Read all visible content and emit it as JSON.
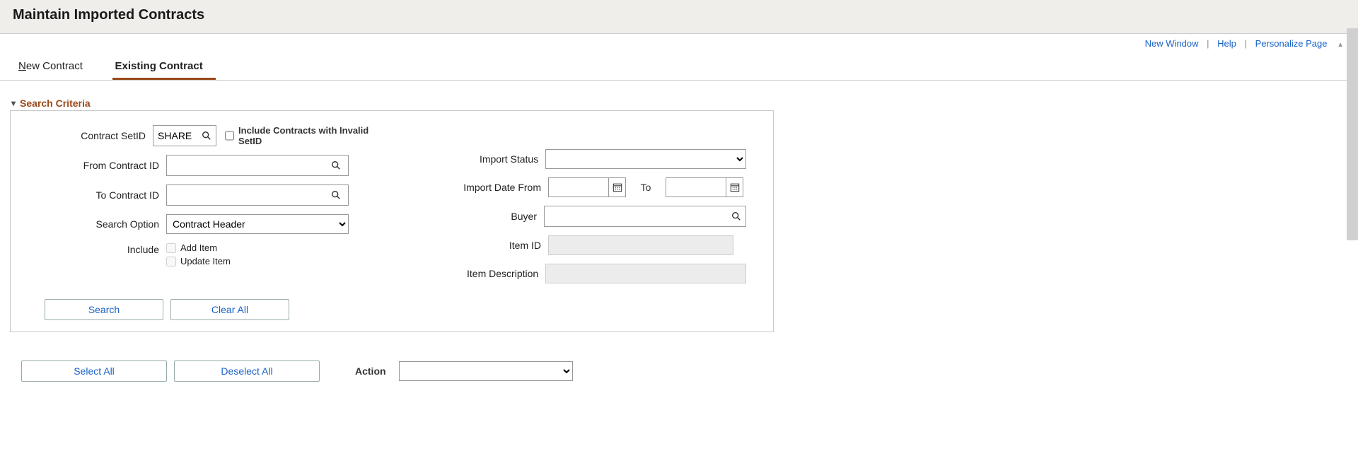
{
  "header": {
    "title": "Maintain Imported Contracts"
  },
  "toplinks": {
    "new_window": "New Window",
    "help": "Help",
    "personalize": "Personalize Page"
  },
  "tabs": {
    "new_contract_first": "N",
    "new_contract_rest": "ew Contract",
    "existing": "Existing Contract"
  },
  "criteria": {
    "heading": "Search Criteria",
    "contract_setid_label": "Contract SetID",
    "contract_setid_value": "SHARE",
    "invalid_setid_label": "Include Contracts with Invalid SetID",
    "from_contract_label": "From Contract ID",
    "from_contract_value": "",
    "to_contract_label": "To Contract ID",
    "to_contract_value": "",
    "search_option_label": "Search Option",
    "search_option_value": "Contract Header",
    "include_label": "Include",
    "add_item_label": "Add Item",
    "update_item_label": "Update Item",
    "import_status_label": "Import Status",
    "import_status_value": "",
    "import_date_from_label": "Import Date From",
    "import_date_from_value": "",
    "import_date_to_label": "To",
    "import_date_to_value": "",
    "buyer_label": "Buyer",
    "buyer_value": "",
    "item_id_label": "Item ID",
    "item_id_value": "",
    "item_desc_label": "Item Description",
    "item_desc_value": "",
    "search_btn": "Search",
    "clear_btn": "Clear All"
  },
  "bottom": {
    "select_all": "Select All",
    "deselect_all": "Deselect All",
    "action_label": "Action",
    "action_value": ""
  }
}
